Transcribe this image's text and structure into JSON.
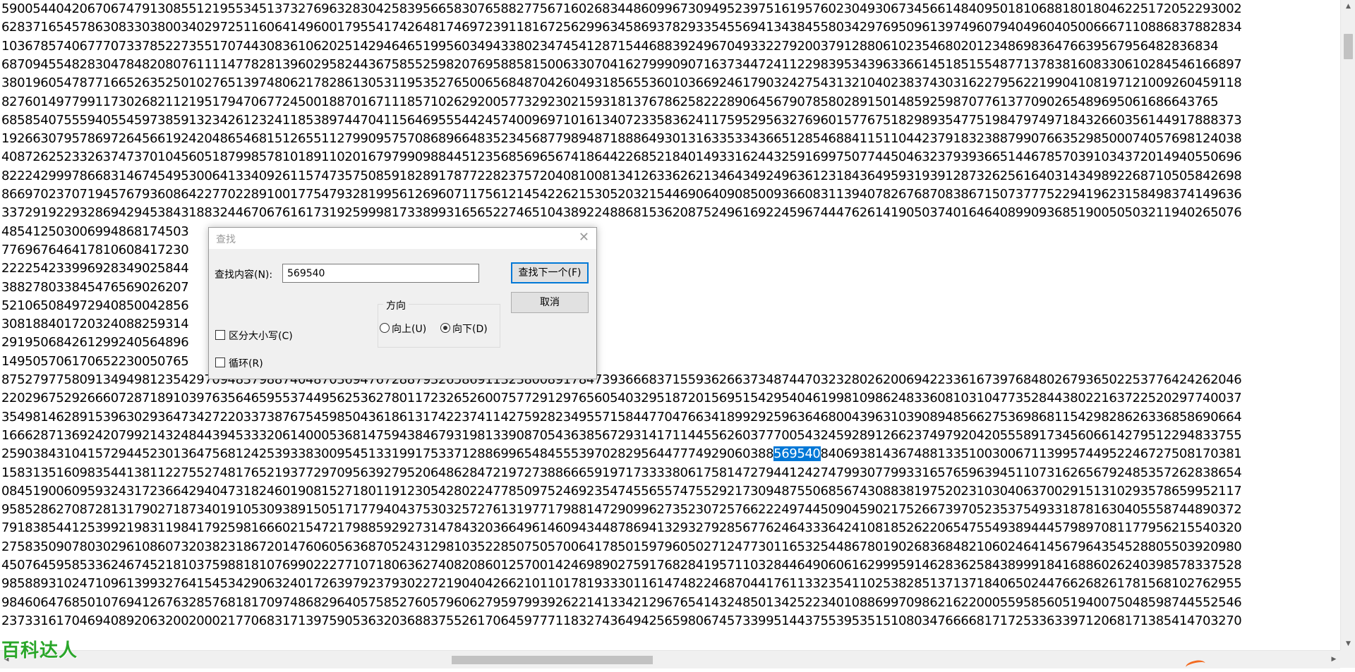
{
  "editor": {
    "lines": [
      "590054404206706747913085512195534513732769632830425839566583076588277567160268344860996730949523975161957602304930673456614840950181068818018046225172052293002",
      "628371654578630833038003402972511606414960017955417426481746972391181672562996345869378293354556941343845580342976950961397496079404960405006667110886837882834",
      "103678574067770733785227355170744308361062025142946465199560349433802347454128715446883924967049332279200379128806102354680201234869836476639567956482836834",
      "687094554828304784820807611114778281396029582443675855259820769588581500633070416279990907163734472411229839534396336614518515548771378381608330610284546166897",
      "380196054787716652635250102765139748062178286130531195352765006568487042604931856553601036692461790324275431321040238374303162279562219904108197121009260459118",
      "827601497799117302682112195179470677245001887016711185710262920057732923021593181376786258222890645679078580289150148592598707761377090265489695061686643765",
      "685854075559405545973859132342612324118538974470411564695554424574009697101613407233583624117595295632769601577675182989354775198479749718432660356144917888373",
      "192663079578697264566192420486546815126551127990957570868966483523456877989487188864930131633533436651285468841151104423791832388799076635298500074057698124038",
      "408726252332637473701045605187998578101891102016797990988445123568569656741864422685218401493316244325916997507744504632379393665144678570391034372014940550696",
      "822242999786683146745495300641334092611574735750859182891787722823757204081008134126336262134643492496361231843649593193912873262561640314349892268710505842698",
      "866970237071945767936086422770228910017754793281995612696071175612145422621530520321544690640908500936608311394078267687083867150737775229419623158498374149636",
      "337291922932869429453843188324467067616173192599981733899316565227465104389224886815362087524961692245967444762614190503740164640899093685190050503211940265076",
      "485412503006994868174503",
      "776967646417810608417230",
      "222254233996928349025844",
      "388278033845476569026207",
      "521065084972940850042856",
      "308188401720324088259314",
      "291950684261299240564896",
      "149505706170652230050765",
      "875279775809134949812354297094837988740487036947672887932658691132380089178473936668371559362663734874470323280262006942233616739768480267936502253776424262046",
      "220296752926660728718910397635646595537449562536278011723265260075772912976560540329518720156951542954046199810986248336081031047735284438022163722520297740037",
      "354981462891539630293647342722033738767545985043618613174223741142759282349557158447704766341899292596364680043963103908948566275369868115429828626336858690664",
      "166628713692420799214324844394533320614000536814759438467931981339087054363856729314171144556260377700543245928912662374979204205558917345606614279512294833755",
      "259038431041572944523013647568124253933830095451331991753371288699654845553970282956447774929060388",
      "158313516098354413811227552748176521937729709563927952064862847219727388666591971733338061758147279441242747993077993316576596394511073162656792485357262838654",
      "084519006095932431723664294047318246019081527180119123054280224778509752469235474556557475529217309487550685674308838197520231030406370029151310293578659952117",
      "958528627087281317902718734019105309389150517177940437530325727613197717988147290996273523072576622249744509045902175266739705235375493318781630405558744890372",
      "791838544125399219831198417925981666021547217988592927314784320366496146094344878694132932792856776246433364241081852622065475549389444579897081177956215540320",
      "275835090780302961086073203823186720147606056368705243129810352285075057006417850159796050271247730116532544867801902683684821060246414567964354528805503920980",
      "450764595853362467452181037598818107699022277107180636274082086012570014246989027591768284195711032844649060616299959146283625843899918416886026240398578337528",
      "985889310247109613993276415453429063240172639792379302272190404266210110178193330116147482246870441761133235411025382851371371840650244766268261781568102762955",
      "984606476850107694126763285768181709748682964057585276057960627959799392622141334212967654143248501342522340108869970986216220005595856051940075048598744552546",
      "237331617046940892063200200021770683171397590536320368837552617064597771183274364942565980674573399514437553953515108034766668171725336339712068171385414703270"
    ],
    "selected_line_index": 24,
    "selected_text": "569540",
    "selected_line_after": "840693814367488133510030067113995744952246727508170381"
  },
  "find_dialog": {
    "title": "查找",
    "find_label": "查找内容(N):",
    "find_value": "569540",
    "find_next_label": "查找下一个(F)",
    "cancel_label": "取消",
    "direction_label": "方向",
    "up_label": "向上(U)",
    "down_label": "向下(D)",
    "direction_selected": "down",
    "match_case_label": "区分大小写(C)",
    "wrap_label": "循环(R)",
    "match_case_checked": false,
    "wrap_checked": false
  },
  "watermark": "百科达人",
  "colors": {
    "selection": "#0078d7",
    "watermark": "#2aa62a",
    "primary_button_border": "#0078d7"
  }
}
